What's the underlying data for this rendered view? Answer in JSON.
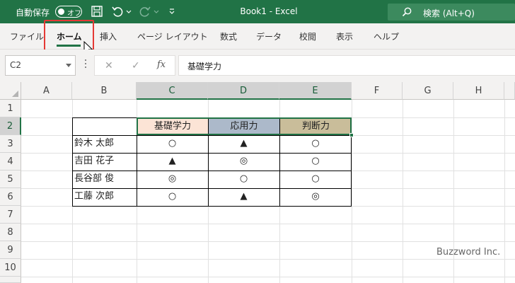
{
  "titlebar": {
    "autosave_label": "自動保存",
    "autosave_state": "オフ",
    "document_title": "Book1  -  Excel",
    "search_placeholder": "検索 (Alt+Q)"
  },
  "ribbon": {
    "tabs": [
      "ファイル",
      "ホーム",
      "挿入",
      "ページ レイアウト",
      "数式",
      "データ",
      "校閲",
      "表示",
      "ヘルプ"
    ],
    "active_tab": "ホーム"
  },
  "formula_bar": {
    "name_box": "C2",
    "formula": "基礎学力",
    "fx_label": "fx"
  },
  "sheet": {
    "columns": [
      "A",
      "B",
      "C",
      "D",
      "E",
      "F",
      "G",
      "H"
    ],
    "rows": [
      "1",
      "2",
      "3",
      "4",
      "5",
      "6",
      "7",
      "8",
      "9",
      "10"
    ],
    "selected_range": "C2:E2",
    "headers": [
      {
        "text": "基礎学力",
        "color": "#fce4d6"
      },
      {
        "text": "応用力",
        "color": "#acb9ca"
      },
      {
        "text": "判断力",
        "color": "#c9bd9a"
      }
    ],
    "table_rows": [
      {
        "name": "鈴木 太郎",
        "values": [
          "○",
          "▲",
          "○"
        ]
      },
      {
        "name": "吉田 花子",
        "values": [
          "▲",
          "◎",
          "○"
        ]
      },
      {
        "name": "長谷部 俊",
        "values": [
          "◎",
          "○",
          "○"
        ]
      },
      {
        "name": "工藤 次郎",
        "values": [
          "○",
          "▲",
          "◎"
        ]
      }
    ]
  },
  "watermark": "Buzzword Inc.",
  "colors": {
    "excel_green": "#217346",
    "highlight_red": "#e53935"
  }
}
